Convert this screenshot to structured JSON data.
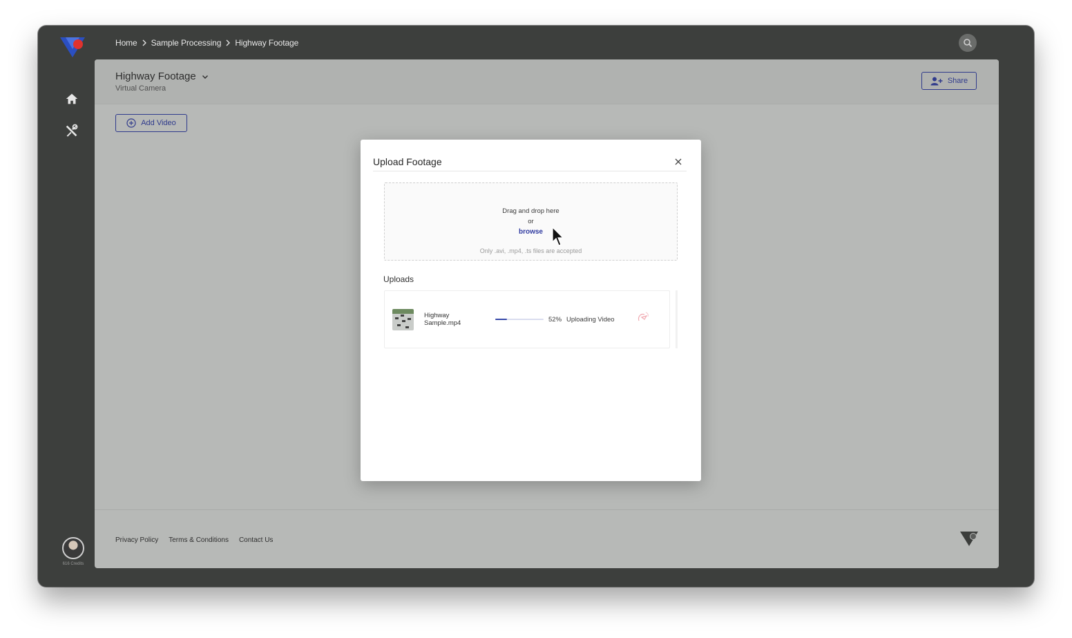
{
  "breadcrumb": [
    "Home",
    "Sample Processing",
    "Highway Footage"
  ],
  "header": {
    "title": "Highway Footage",
    "subtitle": "Virtual Camera",
    "share_label": "Share"
  },
  "actions": {
    "add_video_label": "Add Video"
  },
  "sidebar": {
    "items": [
      {
        "icon": "home-icon"
      },
      {
        "icon": "tools-icon"
      }
    ],
    "user": {
      "credits": "616 Credits"
    }
  },
  "modal": {
    "title": "Upload Footage",
    "dropzone": {
      "line1": "Drag and drop here",
      "line2": "or",
      "browse_label": "browse",
      "hint": "Only .avi, .mp4, .ts files are accepted"
    },
    "uploads_label": "Uploads",
    "uploads": [
      {
        "file_name": "Highway Sample.mp4",
        "progress": 0.52,
        "progress_label": "52%",
        "status": "Uploading Video"
      }
    ]
  },
  "footer": {
    "links": [
      "Privacy Policy",
      "Terms & Conditions",
      "Contact Us"
    ]
  },
  "colors": {
    "accent": "#2f3a8c",
    "brand_blue": "#2b4fc2",
    "brand_red": "#e0322e",
    "chrome": "#3d3f3d",
    "overlay_panel": "#b7b9b7",
    "progress": "#3547a8"
  }
}
